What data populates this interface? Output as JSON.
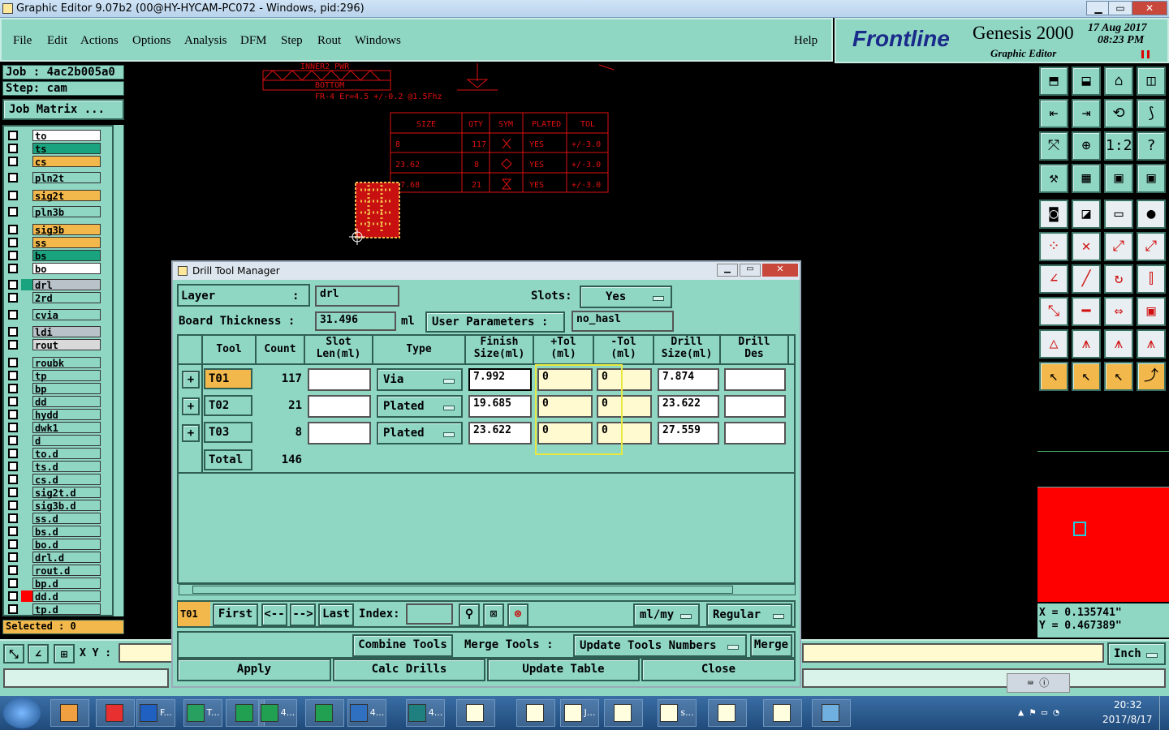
{
  "window": {
    "title": "Graphic Editor 9.07b2 (00@HY-HYCAM-PC072 - Windows, pid:296)"
  },
  "menu": [
    "File",
    "Edit",
    "Actions",
    "Options",
    "Analysis",
    "DFM",
    "Step",
    "Rout",
    "Windows"
  ],
  "menu_help": "Help",
  "brand": {
    "logo": "Frontline",
    "product": "Genesis 2000",
    "subtitle": "Graphic Editor",
    "date": "17 Aug 2017",
    "time": "08:23 PM"
  },
  "job": {
    "job": "Job : 4ac2b005a0",
    "step": "Step: cam",
    "matrix_btn": "Job Matrix ..."
  },
  "layers": [
    {
      "name": "to",
      "color": "#ffffff"
    },
    {
      "name": "ts",
      "color": "#19a37f"
    },
    {
      "name": "cs",
      "color": "#f2b84b"
    },
    {
      "name": "pln2t",
      "color": "#8fd6c3"
    },
    {
      "name": "sig2t",
      "color": "#f2b84b"
    },
    {
      "name": "pln3b",
      "color": "#8fd6c3"
    },
    {
      "name": "sig3b",
      "color": "#f2b84b"
    },
    {
      "name": "ss",
      "color": "#f2b84b"
    },
    {
      "name": "bs",
      "color": "#19a37f"
    },
    {
      "name": "bo",
      "color": "#ffffff"
    },
    {
      "name": "drl",
      "color": "#b8c2c8"
    },
    {
      "name": "2rd",
      "color": "#8fd6c3"
    },
    {
      "name": "cvia",
      "color": "#8fd6c3"
    },
    {
      "name": "ldi",
      "color": "#b8c2c8"
    },
    {
      "name": "rout",
      "color": "#d9d9d9"
    },
    {
      "name": "roubk",
      "color": "#8fd6c3"
    },
    {
      "name": "tp",
      "color": "#8fd6c3"
    },
    {
      "name": "bp",
      "color": "#8fd6c3"
    },
    {
      "name": "dd",
      "color": "#8fd6c3"
    },
    {
      "name": "hydd",
      "color": "#8fd6c3"
    },
    {
      "name": "dwk1",
      "color": "#8fd6c3"
    },
    {
      "name": "d",
      "color": "#8fd6c3"
    },
    {
      "name": "to.d",
      "color": "#8fd6c3"
    },
    {
      "name": "ts.d",
      "color": "#8fd6c3"
    },
    {
      "name": "cs.d",
      "color": "#8fd6c3"
    },
    {
      "name": "sig2t.d",
      "color": "#8fd6c3"
    },
    {
      "name": "sig3b.d",
      "color": "#8fd6c3"
    },
    {
      "name": "ss.d",
      "color": "#8fd6c3"
    },
    {
      "name": "bs.d",
      "color": "#8fd6c3"
    },
    {
      "name": "bo.d",
      "color": "#8fd6c3"
    },
    {
      "name": "drl.d",
      "color": "#8fd6c3"
    },
    {
      "name": "rout.d",
      "color": "#8fd6c3"
    },
    {
      "name": "bp.d",
      "color": "#8fd6c3"
    },
    {
      "name": "dd.d",
      "color": "#8fd6c3"
    },
    {
      "name": "tp.d",
      "color": "#8fd6c3"
    }
  ],
  "selected": "Selected : 0",
  "xy_label": "X Y :",
  "unit_btn": "Inch",
  "coords": {
    "x": "X = 0.135741\"",
    "y": "Y = 0.467389\""
  },
  "canvas": {
    "stack_top": "INNER2 PWR",
    "stack_mid": "BOTTOM",
    "stack_note": "FR-4  Er=4.5 +/-0.2 @1.5Fhz",
    "table_head": [
      "SIZE",
      "QTY",
      "SYM",
      "PLATED",
      "TOL"
    ],
    "table_rows": [
      [
        "8",
        "117",
        "",
        "YES",
        "+/-3.0"
      ],
      [
        "23.62",
        "8",
        "",
        "YES",
        "+/-3.0"
      ],
      [
        "27.68",
        "21",
        "",
        "YES",
        "+/-3.0"
      ]
    ]
  },
  "dialog": {
    "title": "Drill Tool Manager",
    "layer_label": "Layer",
    "layer_colon": ":",
    "layer_value": "drl",
    "slots_label": "Slots:",
    "slots_value": "Yes",
    "thickness_label": "Board Thickness :",
    "thickness_value": "31.496",
    "thickness_unit": "ml",
    "user_params_btn": "User Parameters  :",
    "user_params_value": "no_hasl",
    "headers": [
      "Tool",
      "Count",
      "Slot\nLen(ml)",
      "Type",
      "Finish\nSize(ml)",
      "+Tol\n(ml)",
      "-Tol\n(ml)",
      "Drill\nSize(ml)",
      "Drill\nDes"
    ],
    "rows": [
      {
        "tool": "T01",
        "count": "117",
        "slot": "",
        "type": "Via",
        "finish": "7.992",
        "ptol": "0",
        "mtol": "0",
        "drill": "7.874",
        "des": ""
      },
      {
        "tool": "T02",
        "count": "21",
        "slot": "",
        "type": "Plated",
        "finish": "19.685",
        "ptol": "0",
        "mtol": "0",
        "drill": "23.622",
        "des": ""
      },
      {
        "tool": "T03",
        "count": "8",
        "slot": "",
        "type": "Plated",
        "finish": "23.622",
        "ptol": "0",
        "mtol": "0",
        "drill": "27.559",
        "des": ""
      }
    ],
    "total_label": "Total",
    "total_value": "146",
    "nav": {
      "current": "T01",
      "first": "First",
      "prev": "<--",
      "next": "-->",
      "last": "Last",
      "index_label": "Index:",
      "unit": "ml/my",
      "mode": "Regular"
    },
    "actions": {
      "combine": "Combine Tools",
      "merge_label": "Merge Tools :",
      "update_numbers": "Update Tools Numbers",
      "merge": "Merge"
    },
    "bottom": {
      "apply": "Apply",
      "calc": "Calc Drills",
      "update": "Update Table",
      "close": "Close"
    }
  },
  "taskbar": {
    "items": [
      "",
      "",
      "F...",
      "T...",
      "",
      "4...",
      "",
      "4...",
      "4...",
      "",
      "",
      "J...",
      "",
      "s...",
      "",
      "",
      ""
    ],
    "time": "20:32",
    "date": "2017/8/17"
  }
}
